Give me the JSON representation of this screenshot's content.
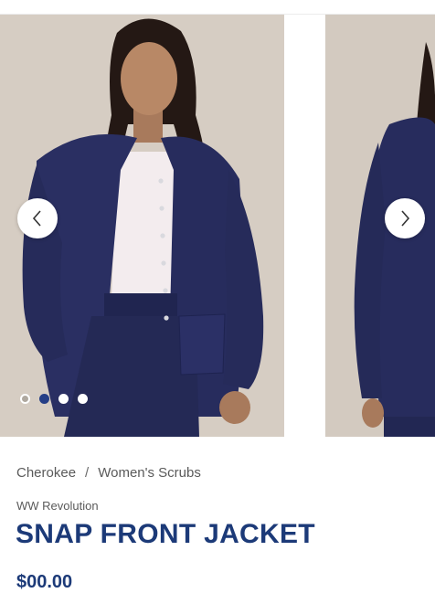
{
  "carousel": {
    "slide_count": 4,
    "active_index": 1,
    "prev_icon": "chevron-left-icon",
    "next_icon": "chevron-right-icon"
  },
  "breadcrumb": {
    "brand": "Cherokee",
    "separator": "/",
    "category": "Women's Scrubs"
  },
  "product": {
    "collection": "WW Revolution",
    "title": "SNAP FRONT JACKET",
    "price_partial": "$00.00"
  },
  "colors": {
    "navy_title": "#1c3a78",
    "dot_active": "#253e86",
    "scrub_navy": "#2a2f62"
  }
}
